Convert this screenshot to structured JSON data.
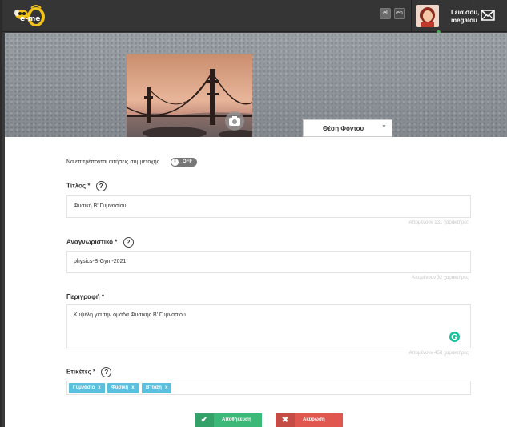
{
  "header": {
    "logo_text": "e-me",
    "lang_el": "el",
    "lang_en": "en",
    "greeting_line1": "Γεια σου,",
    "greeting_line2": "megalou"
  },
  "banner": {
    "bg_position_label": "Θέση Φόντου"
  },
  "form": {
    "join_requests_label": "Να επιτρέπονται αιτήσεις συμμετοχής",
    "join_requests_toggle": "OFF",
    "title_label": "Τίτλος",
    "title_value": "Φυσική Β' Γυμνασίου",
    "title_counter": "Απομένουν 131 χαρακτήρες",
    "id_label": "Αναγνωριστικό",
    "id_value": "physics-B-Gym-2021",
    "id_counter": "Απομένουν 32 χαρακτήρες",
    "desc_label": "Περιγραφή",
    "desc_value": "Κυψέλη για την ομάδα Φυσικής Β' Γυμνασίου",
    "desc_counter": "Απομένουν 458 χαρακτήρες",
    "tags_label": "Ετικέτες",
    "tags": [
      {
        "label": "Γυμνάσιο"
      },
      {
        "label": "Φυσική"
      },
      {
        "label": "Β' τάξη"
      }
    ],
    "required_mark": "*",
    "help_mark": "?",
    "tag_remove": "x"
  },
  "actions": {
    "save_label": "Αποθήκευση",
    "cancel_label": "Ακύρωση"
  },
  "colors": {
    "save": "#3cb878",
    "cancel": "#e0574f",
    "tag": "#5bc0de",
    "grammarly": "#15c39a"
  }
}
